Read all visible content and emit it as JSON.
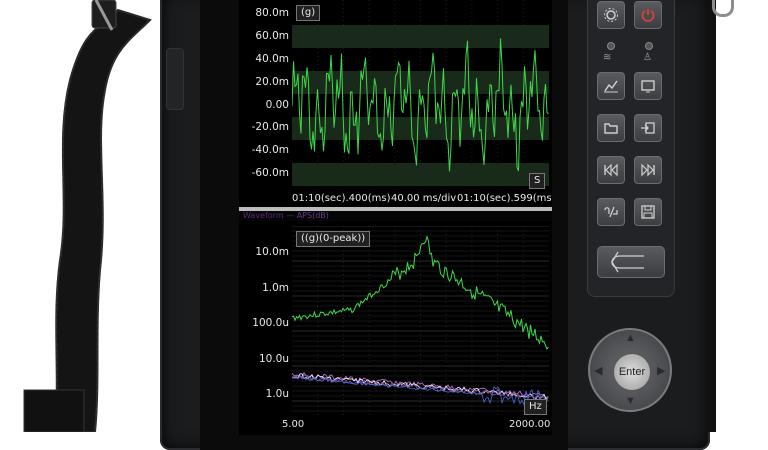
{
  "top_panel": {
    "unit": "(g)",
    "y_ticks": [
      "80.0m",
      "60.0m",
      "40.0m",
      "20.0m",
      "0.00",
      "-20.0m",
      "-40.0m",
      "-60.0m"
    ],
    "x_unit": "S",
    "time_start": "01:10(sec).400(ms)",
    "time_div": "40.00 ms/div",
    "time_end": "01:10(sec).599(ms)",
    "trace_color": "#3ed94a"
  },
  "legend": {
    "item1": "Waveform",
    "item2": "APS(dB)"
  },
  "bottom_panel": {
    "unit": "((g)(0-peak))",
    "y_ticks": [
      "10.0m",
      "1.0m",
      "100.0u",
      "10.0u",
      "1.0u"
    ],
    "x_start": "5.00",
    "x_end": "2000.00",
    "x_unit": "Hz",
    "trace_color": "#3ed94a"
  },
  "keypad": {
    "enter_label": "Enter"
  },
  "colors": {
    "screen_bg": "#000000",
    "grid_band": "#1a2a1a",
    "device_body": "#1b1c1e"
  }
}
